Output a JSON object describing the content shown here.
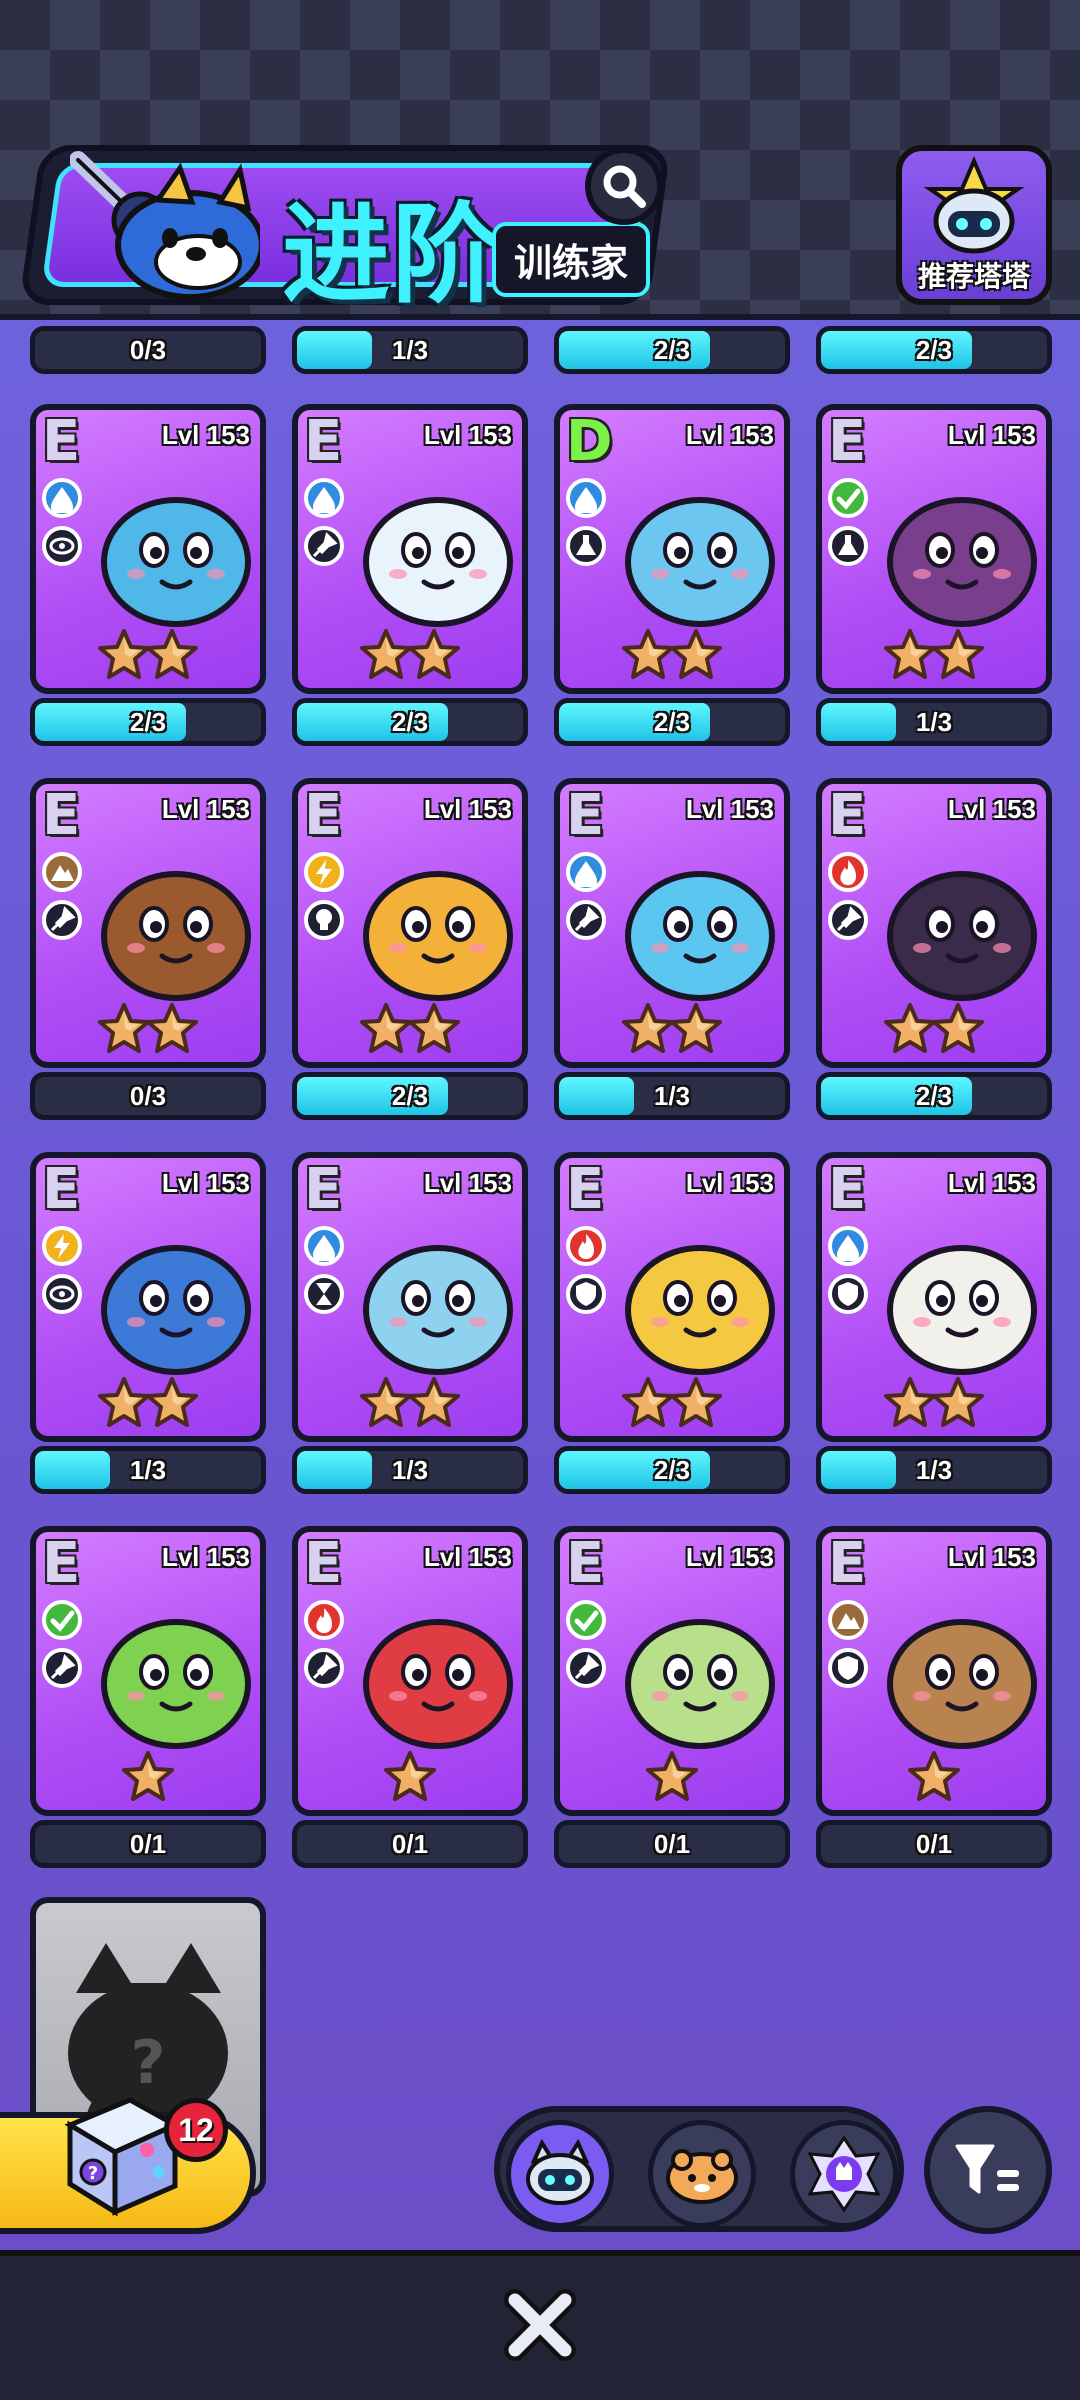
{
  "header": {
    "title": "进阶",
    "subtitle": "训练家",
    "recommend_label": "推荐塔塔"
  },
  "top_bars": [
    {
      "text": "0/3",
      "fill": 0
    },
    {
      "text": "1/3",
      "fill": 0.33
    },
    {
      "text": "2/3",
      "fill": 0.67
    },
    {
      "text": "2/3",
      "fill": 0.67
    }
  ],
  "cards": [
    {
      "rank": "E",
      "level": "Lvl 153",
      "element": "water",
      "role": "eye",
      "stars": 2,
      "progress": "2/3",
      "fill": 0.67,
      "color": "#4fb8e8"
    },
    {
      "rank": "E",
      "level": "Lvl 153",
      "element": "water",
      "role": "pin",
      "stars": 2,
      "progress": "2/3",
      "fill": 0.67,
      "color": "#e8f3fb"
    },
    {
      "rank": "D",
      "level": "Lvl 153",
      "element": "water",
      "role": "flask",
      "stars": 2,
      "progress": "2/3",
      "fill": 0.67,
      "color": "#6cc6ef"
    },
    {
      "rank": "E",
      "level": "Lvl 153",
      "element": "grass",
      "role": "flask",
      "stars": 2,
      "progress": "1/3",
      "fill": 0.33,
      "color": "#7a3f8c"
    },
    {
      "rank": "E",
      "level": "Lvl 153",
      "element": "earth",
      "role": "pin",
      "stars": 2,
      "progress": "0/3",
      "fill": 0,
      "color": "#9b5a2e"
    },
    {
      "rank": "E",
      "level": "Lvl 153",
      "element": "electric",
      "role": "bulb",
      "stars": 2,
      "progress": "2/3",
      "fill": 0.67,
      "color": "#f3b13a"
    },
    {
      "rank": "E",
      "level": "Lvl 153",
      "element": "water",
      "role": "pin",
      "stars": 2,
      "progress": "1/3",
      "fill": 0.33,
      "color": "#5bc6f0"
    },
    {
      "rank": "E",
      "level": "Lvl 153",
      "element": "fire",
      "role": "pin",
      "stars": 2,
      "progress": "2/3",
      "fill": 0.67,
      "color": "#3a2b4a"
    },
    {
      "rank": "E",
      "level": "Lvl 153",
      "element": "electric",
      "role": "eye",
      "stars": 2,
      "progress": "1/3",
      "fill": 0.33,
      "color": "#3d7ad8"
    },
    {
      "rank": "E",
      "level": "Lvl 153",
      "element": "water",
      "role": "hourglass",
      "stars": 2,
      "progress": "1/3",
      "fill": 0.33,
      "color": "#8fd2f0"
    },
    {
      "rank": "E",
      "level": "Lvl 153",
      "element": "fire",
      "role": "shield",
      "stars": 2,
      "progress": "2/3",
      "fill": 0.67,
      "color": "#f5c842"
    },
    {
      "rank": "E",
      "level": "Lvl 153",
      "element": "water",
      "role": "shield",
      "stars": 2,
      "progress": "1/3",
      "fill": 0.33,
      "color": "#f2f0ea"
    },
    {
      "rank": "E",
      "level": "Lvl 153",
      "element": "grass",
      "role": "pin",
      "stars": 1,
      "progress": "0/1",
      "fill": 0,
      "color": "#7ed24f"
    },
    {
      "rank": "E",
      "level": "Lvl 153",
      "element": "fire",
      "role": "pin",
      "stars": 1,
      "progress": "0/1",
      "fill": 0,
      "color": "#e03c44"
    },
    {
      "rank": "E",
      "level": "Lvl 153",
      "element": "grass",
      "role": "pin",
      "stars": 1,
      "progress": "0/1",
      "fill": 0,
      "color": "#b8e08a"
    },
    {
      "rank": "E",
      "level": "Lvl 153",
      "element": "earth",
      "role": "shield",
      "stars": 1,
      "progress": "0/1",
      "fill": 0,
      "color": "#b98350"
    }
  ],
  "element_colors": {
    "water": "#2f8ce0",
    "grass": "#43b83c",
    "earth": "#9a6a3a",
    "electric": "#f2b21d",
    "fire": "#e2342f"
  },
  "mystery_card": {
    "label": "?"
  },
  "gacha": {
    "count": "12"
  },
  "tabs": [
    "pet-tab",
    "food-tab",
    "badge-tab"
  ],
  "colors": {
    "accent_cyan": "#3ff0ff",
    "card_purple": "#b04df5",
    "background": "#6b5fd4"
  }
}
